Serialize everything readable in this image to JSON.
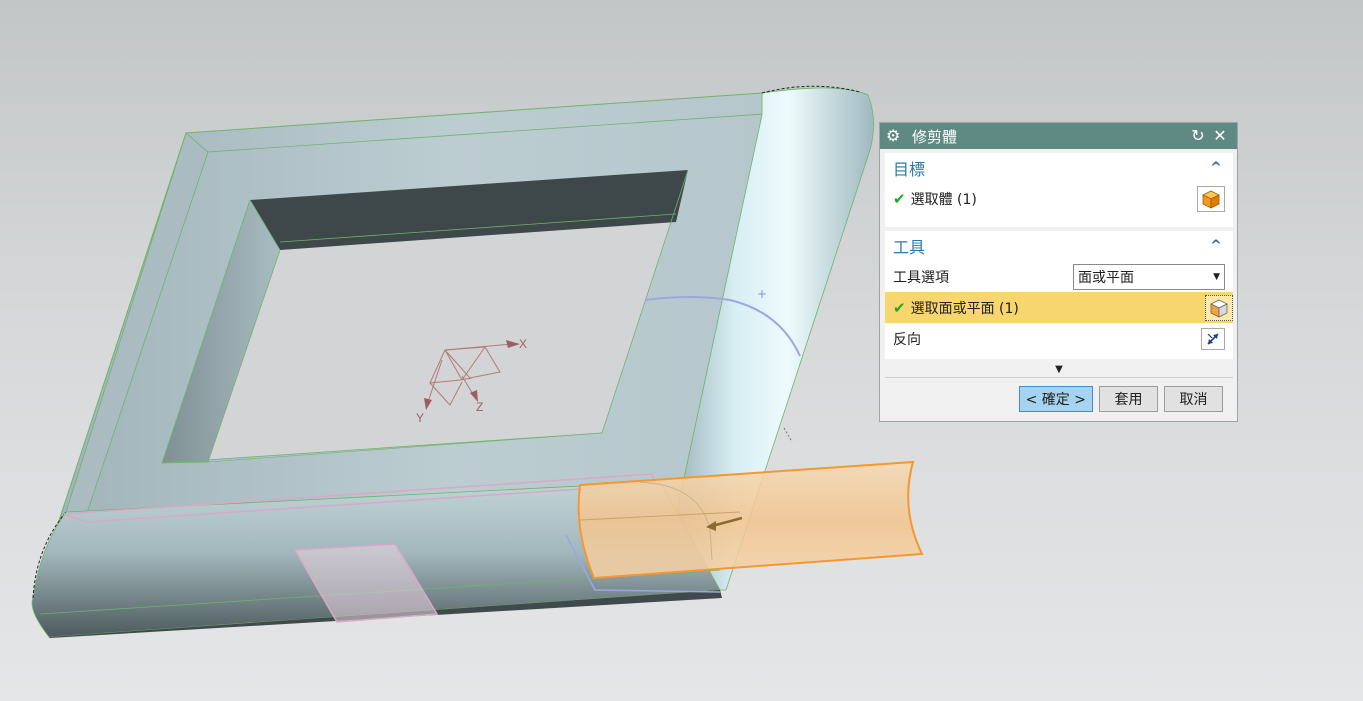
{
  "viewport": {
    "axis_labels": {
      "x": "X",
      "y": "Y",
      "z": "Z"
    }
  },
  "dialog": {
    "title": "修剪體",
    "reset_icon": "reset-icon",
    "close_icon": "close-icon",
    "gear_icon": "gear-icon",
    "target_section": {
      "label": "目標",
      "select_body_label": "選取體 (1)",
      "select_body_icon": "solid-body-icon"
    },
    "tool_section": {
      "label": "工具",
      "tool_option_label": "工具選項",
      "tool_option_value": "面或平面",
      "select_face_label": "選取面或平面 (1)",
      "select_face_icon": "face-select-icon",
      "reverse_label": "反向",
      "reverse_icon": "reverse-direction-icon"
    },
    "buttons": {
      "ok": "< 確定 >",
      "apply": "套用",
      "cancel": "取消"
    }
  }
}
